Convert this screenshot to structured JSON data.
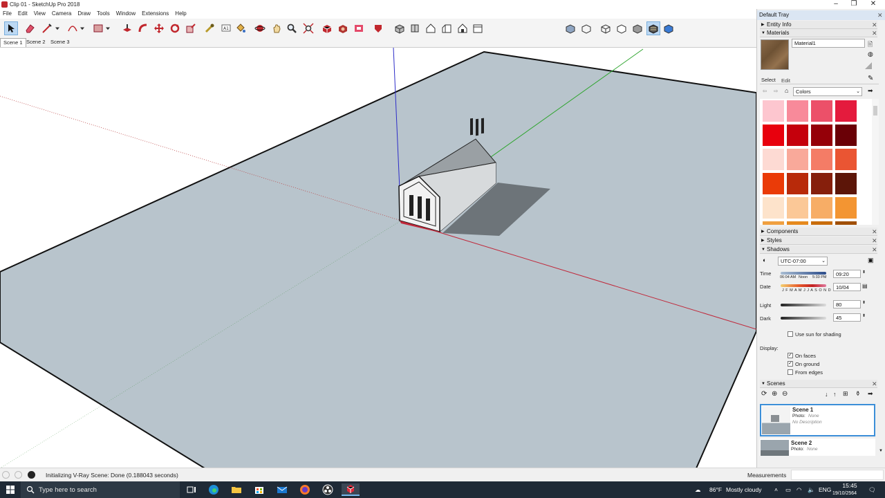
{
  "window": {
    "title": "Clip 01 - SketchUp Pro 2018",
    "controls": [
      "–",
      "❐",
      "✕"
    ]
  },
  "menu": [
    "File",
    "Edit",
    "View",
    "Camera",
    "Draw",
    "Tools",
    "Window",
    "Extensions",
    "Help"
  ],
  "scenes_tabs": [
    "Scene 1",
    "Scene 2",
    "Scene 3"
  ],
  "status": {
    "message": "Initializing V-Ray Scene: Done (0.188043 seconds)",
    "measurements_label": "Measurements"
  },
  "tray": {
    "title": "Default Tray",
    "entity_info": "Entity Info",
    "materials": {
      "header": "Materials",
      "material_name": "Material1",
      "tab_select": "Select",
      "tab_edit": "Edit",
      "library": "Colors",
      "swatches": [
        "#fdc6cf",
        "#f88a9a",
        "#ec5069",
        "#e41b3d",
        "#e8000d",
        "#c5000c",
        "#950008",
        "#6a0006",
        "#fddad3",
        "#f9a99a",
        "#f47c66",
        "#ea5533",
        "#ea3b08",
        "#b82a0a",
        "#861f0c",
        "#5c1508",
        "#fde3cb",
        "#fbc897",
        "#f7ad66",
        "#f39532"
      ]
    },
    "components": "Components",
    "styles": "Styles",
    "shadows": {
      "header": "Shadows",
      "timezone": "UTC-07:00",
      "time_label": "Time",
      "time_start": "06:04 AM",
      "time_noon": "Noon",
      "time_end": "5:33 PM",
      "time_value": "09:20",
      "date_label": "Date",
      "months": "J F M A M J J A S O N D",
      "date_value": "10/04",
      "light_label": "Light",
      "light_value": "80",
      "dark_label": "Dark",
      "dark_value": "45",
      "use_sun": "Use sun for shading",
      "display_label": "Display:",
      "on_faces": "On faces",
      "on_ground": "On ground",
      "from_edges": "From edges"
    },
    "scenes": {
      "header": "Scenes",
      "items": [
        {
          "name": "Scene 1",
          "photo_label": "Photo:",
          "photo": "None",
          "desc": "No Description"
        },
        {
          "name": "Scene 2",
          "photo_label": "Photo:",
          "photo": "None"
        }
      ]
    }
  },
  "taskbar": {
    "search_placeholder": "Type here to search",
    "weather_temp": "86°F",
    "weather_text": "Mostly cloudy",
    "lang": "ENG",
    "time": "15:45",
    "date": "19/10/2564"
  }
}
